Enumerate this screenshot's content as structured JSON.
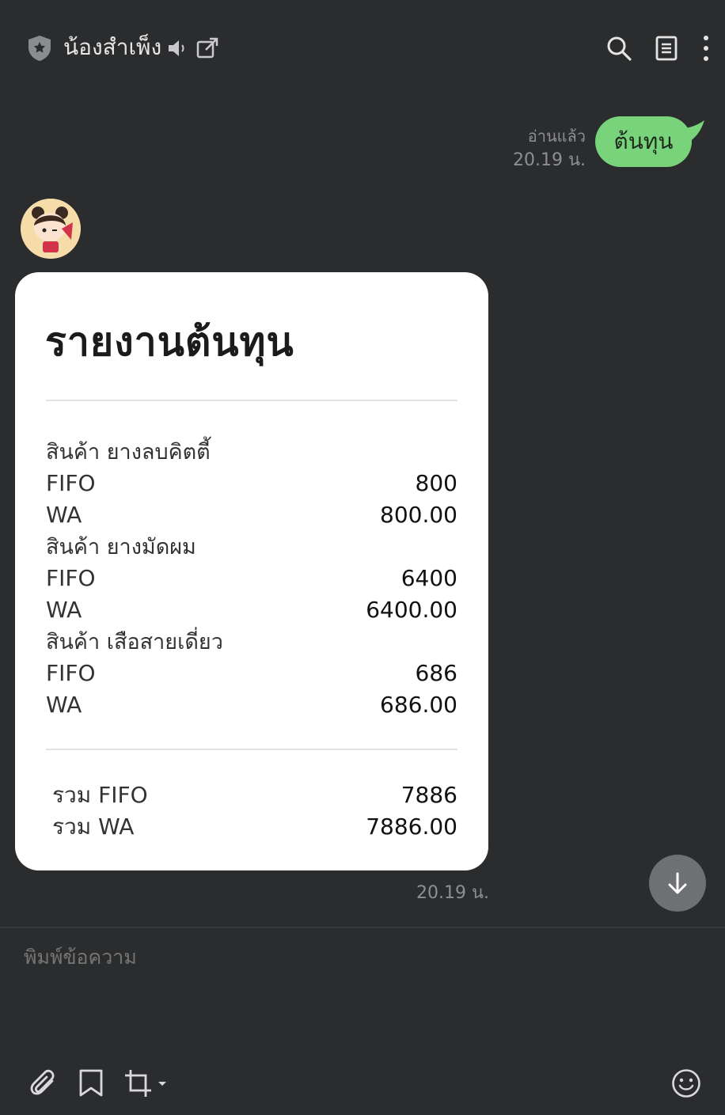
{
  "header": {
    "title": "น้องสำเพ็ง",
    "icons": [
      "shield-icon",
      "mute-icon",
      "external-link-icon",
      "search-icon",
      "notes-icon",
      "more-vertical-icon"
    ]
  },
  "sent_message": {
    "text": "ต้นทุน",
    "read_label": "อ่านแล้ว",
    "time": "20.19 น.",
    "bubble_color": "#79d37a"
  },
  "report": {
    "title": "รายงานต้นทุน",
    "products": [
      {
        "label": "สินค้า ยางลบคิตตี้",
        "fifo_label": "FIFO",
        "fifo": "800",
        "wa_label": "WA",
        "wa": "800.00"
      },
      {
        "label": "สินค้า ยางมัดผม",
        "fifo_label": "FIFO",
        "fifo": "6400",
        "wa_label": "WA",
        "wa": "6400.00"
      },
      {
        "label": "สินค้า เสือสายเดี่ยว",
        "fifo_label": "FIFO",
        "fifo": "686",
        "wa_label": "WA",
        "wa": "686.00"
      }
    ],
    "totals": {
      "fifo_label": "รวม FIFO",
      "fifo": "7886",
      "wa_label": "รวม WA",
      "wa": "7886.00"
    },
    "time": "20.19 น."
  },
  "composer": {
    "placeholder": "พิมพ์ข้อความ",
    "icons": [
      "paperclip-icon",
      "bookmark-icon",
      "crop-icon",
      "emoji-icon"
    ]
  },
  "colors": {
    "background": "#2b2c2e",
    "card": "#ffffff",
    "accent_green": "#79d37a"
  }
}
